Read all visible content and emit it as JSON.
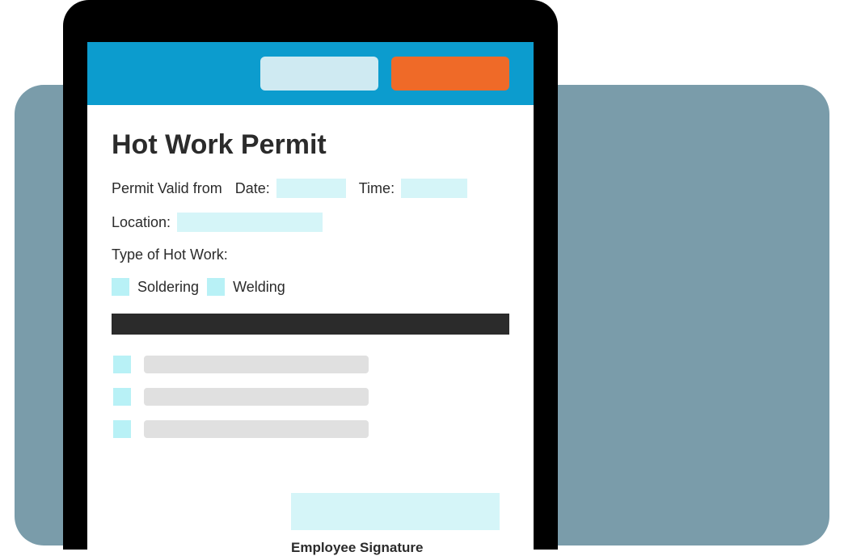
{
  "form": {
    "title": "Hot Work Permit",
    "valid_from_label": "Permit Valid from",
    "date_label": "Date:",
    "time_label": "Time:",
    "location_label": "Location:",
    "type_label": "Type of Hot Work:",
    "options": {
      "soldering": "Soldering",
      "welding": "Welding"
    },
    "signature_label": "Employee Signature"
  }
}
